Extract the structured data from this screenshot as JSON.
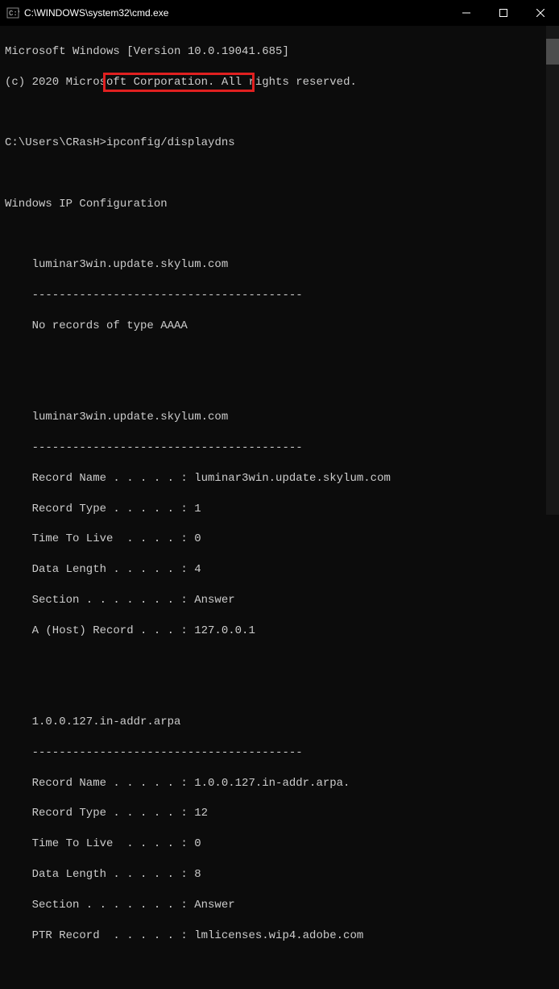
{
  "titlebar": {
    "title": "C:\\WINDOWS\\system32\\cmd.exe"
  },
  "header": {
    "line1": "Microsoft Windows [Version 10.0.19041.685]",
    "line2": "(c) 2020 Microsoft Corporation. All rights reserved."
  },
  "prompt": {
    "path": "C:\\Users\\CRasH>",
    "command": "ipconfig/displaydns"
  },
  "config_heading": "Windows IP Configuration",
  "entries": [
    {
      "host": "luminar3win.update.skylum.com",
      "dashes": "----------------------------------------",
      "norecords": "No records of type AAAA",
      "records": []
    },
    {
      "host": "luminar3win.update.skylum.com",
      "dashes": "----------------------------------------",
      "records": [
        {
          "label": "Record Name . . . . . :",
          "value": " luminar3win.update.skylum.com"
        },
        {
          "label": "Record Type . . . . . :",
          "value": " 1"
        },
        {
          "label": "Time To Live  . . . . :",
          "value": " 0"
        },
        {
          "label": "Data Length . . . . . :",
          "value": " 4"
        },
        {
          "label": "Section . . . . . . . :",
          "value": " Answer"
        },
        {
          "label": "A (Host) Record . . . :",
          "value": " 127.0.0.1"
        }
      ]
    },
    {
      "host": "1.0.0.127.in-addr.arpa",
      "dashes": "----------------------------------------",
      "records": [
        {
          "label": "Record Name . . . . . :",
          "value": " 1.0.0.127.in-addr.arpa."
        },
        {
          "label": "Record Type . . . . . :",
          "value": " 12"
        },
        {
          "label": "Time To Live  . . . . :",
          "value": " 0"
        },
        {
          "label": "Data Length . . . . . :",
          "value": " 8"
        },
        {
          "label": "Section . . . . . . . :",
          "value": " Answer"
        },
        {
          "label": "PTR Record  . . . . . :",
          "value": " lmlicenses.wip4.adobe.com"
        }
      ]
    }
  ]
}
